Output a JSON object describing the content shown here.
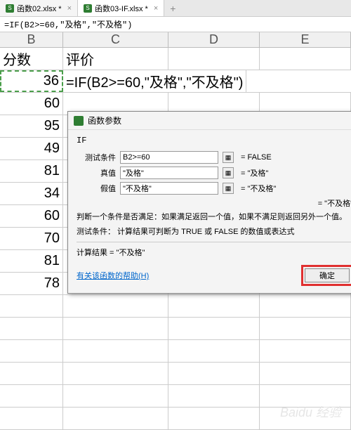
{
  "tabs": [
    {
      "label": "函数02.xlsx *"
    },
    {
      "label": "函数03-IF.xlsx *"
    }
  ],
  "formula_bar": "=IF(B2>=60,\"及格\",\"不及格\")",
  "columns": [
    "B",
    "C",
    "D",
    "E"
  ],
  "header_row": {
    "b": "分数",
    "c": "评价"
  },
  "editing_cell": {
    "b": "36",
    "formula": "=IF(B2>=60,\"及格\",\"不及格\")"
  },
  "data_rows": [
    {
      "b": "60"
    },
    {
      "b": "95"
    },
    {
      "b": "49"
    },
    {
      "b": "81"
    },
    {
      "b": "34"
    },
    {
      "b": "60"
    },
    {
      "b": "70"
    },
    {
      "b": "81"
    },
    {
      "b": "78"
    }
  ],
  "dialog": {
    "title": "函数参数",
    "fn": "IF",
    "params": [
      {
        "label": "测试条件",
        "value": "B2>=60",
        "result": "= FALSE"
      },
      {
        "label": "真值",
        "value": "\"及格\"",
        "result": "= \"及格\""
      },
      {
        "label": "假值",
        "value": "\"不及格\"",
        "result": "= \"不及格\""
      }
    ],
    "preview": "= \"不及格\"",
    "desc1": "判断一个条件是否满足：如果满足返回一个值，如果不满足则返回另外一个值。",
    "desc2": "测试条件： 计算结果可判断为 TRUE 或 FALSE 的数值或表达式",
    "result": "计算结果 = \"不及格\"",
    "help": "有关该函数的帮助(H)",
    "ok": "确定"
  },
  "watermark": "Baidu 经验"
}
